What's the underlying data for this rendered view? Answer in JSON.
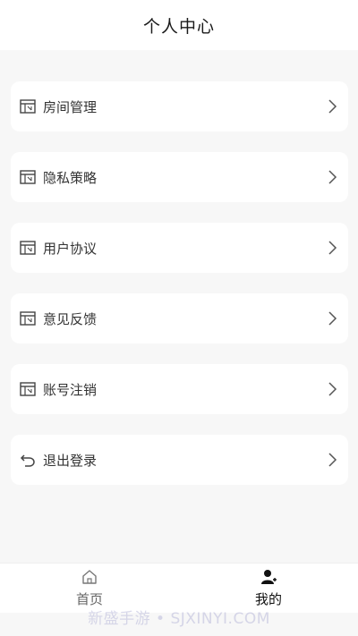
{
  "header": {
    "title": "个人中心"
  },
  "menu": {
    "items": [
      {
        "label": "房间管理",
        "icon": "room-icon"
      },
      {
        "label": "隐私策略",
        "icon": "room-icon"
      },
      {
        "label": "用户协议",
        "icon": "room-icon"
      },
      {
        "label": "意见反馈",
        "icon": "room-icon"
      },
      {
        "label": "账号注销",
        "icon": "room-icon"
      },
      {
        "label": "退出登录",
        "icon": "back-arrow-icon"
      }
    ]
  },
  "tabbar": {
    "tabs": [
      {
        "label": "首页",
        "icon": "home-icon",
        "active": false
      },
      {
        "label": "我的",
        "icon": "user-icon",
        "active": true
      }
    ]
  },
  "watermark": "新盛手游 • SJXINYI.COM",
  "colors": {
    "background": "#f7f7f7",
    "card": "#ffffff",
    "text": "#333333"
  }
}
